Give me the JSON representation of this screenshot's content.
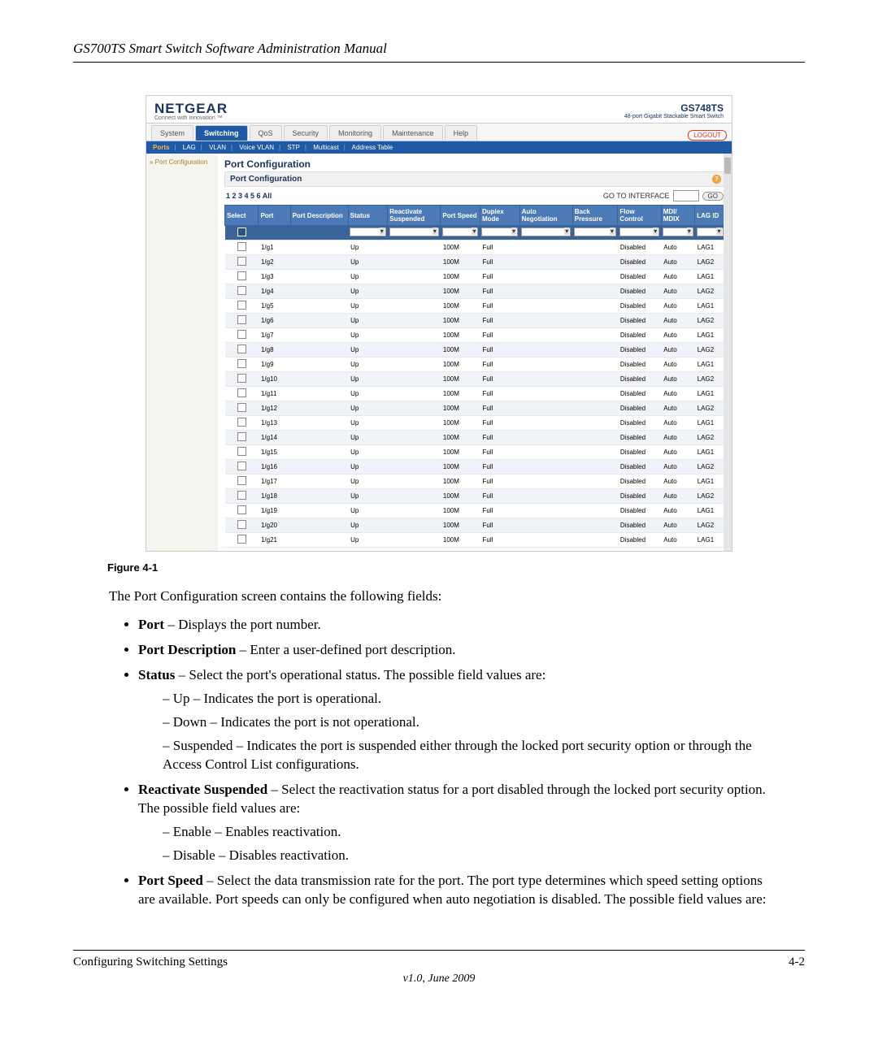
{
  "doc": {
    "header": "GS700TS Smart Switch Software Administration Manual",
    "figure_caption": "Figure 4-1",
    "intro": "The Port Configuration screen contains the following fields:",
    "footer_left": "Configuring Switching Settings",
    "footer_right": "4-2",
    "footer_center": "v1.0, June 2009"
  },
  "fields": {
    "port": {
      "term": "Port",
      "desc": " – Displays the port number."
    },
    "port_desc": {
      "term": "Port Description",
      "desc": " – Enter a user-defined port description."
    },
    "status": {
      "term": "Status",
      "desc": " – Select the port's operational status. The possible field values are:",
      "opts": [
        "Up – Indicates the port is operational.",
        "Down – Indicates the port is not operational.",
        "Suspended – Indicates the port is suspended either through the locked port security option or through the Access Control List configurations."
      ]
    },
    "reactivate": {
      "term": "Reactivate Suspended",
      "desc": " – Select the reactivation status for a port disabled through the locked port security option. The possible field values are:",
      "opts": [
        "Enable – Enables reactivation.",
        "Disable – Disables reactivation."
      ]
    },
    "port_speed": {
      "term": "Port Speed",
      "desc": " – Select the data transmission rate for the port. The port type determines which speed setting options are available. Port speeds can only be configured when auto negotiation is disabled. The possible field values are:"
    }
  },
  "ui": {
    "brand": "NETGEAR",
    "brand_tag": "Connect with Innovation ™",
    "model": "GS748TS",
    "model_tag": "48-port Gigabit Stackable Smart Switch",
    "tabs": [
      "System",
      "Switching",
      "QoS",
      "Security",
      "Monitoring",
      "Maintenance",
      "Help"
    ],
    "active_tab": "Switching",
    "logout": "LOGOUT",
    "subtabs": [
      "Ports",
      "LAG",
      "VLAN",
      "Voice VLAN",
      "STP",
      "Multicast",
      "Address Table"
    ],
    "sidebar_item": "» Port Configuration",
    "section_title": "Port Configuration",
    "section_sub": "Port Configuration",
    "paginator": "1 2 3 4 5 6 All",
    "goto_label": "GO TO INTERFACE",
    "go_btn": "GO",
    "columns": [
      "Select",
      "Port",
      "Port Description",
      "Status",
      "Reactivate Suspended",
      "Port Speed",
      "Duplex Mode",
      "Auto Negotiation",
      "Back Pressure",
      "Flow Control",
      "MDI/ MDIX",
      "LAG ID"
    ],
    "rows": [
      {
        "port": "1/g1",
        "status": "Up",
        "speed": "100M",
        "duplex": "Full",
        "flow": "Disabled",
        "mdi": "Auto",
        "lag": "LAG1"
      },
      {
        "port": "1/g2",
        "status": "Up",
        "speed": "100M",
        "duplex": "Full",
        "flow": "Disabled",
        "mdi": "Auto",
        "lag": "LAG2"
      },
      {
        "port": "1/g3",
        "status": "Up",
        "speed": "100M",
        "duplex": "Full",
        "flow": "Disabled",
        "mdi": "Auto",
        "lag": "LAG1"
      },
      {
        "port": "1/g4",
        "status": "Up",
        "speed": "100M",
        "duplex": "Full",
        "flow": "Disabled",
        "mdi": "Auto",
        "lag": "LAG2"
      },
      {
        "port": "1/g5",
        "status": "Up",
        "speed": "100M",
        "duplex": "Full",
        "flow": "Disabled",
        "mdi": "Auto",
        "lag": "LAG1"
      },
      {
        "port": "1/g6",
        "status": "Up",
        "speed": "100M",
        "duplex": "Full",
        "flow": "Disabled",
        "mdi": "Auto",
        "lag": "LAG2"
      },
      {
        "port": "1/g7",
        "status": "Up",
        "speed": "100M",
        "duplex": "Full",
        "flow": "Disabled",
        "mdi": "Auto",
        "lag": "LAG1"
      },
      {
        "port": "1/g8",
        "status": "Up",
        "speed": "100M",
        "duplex": "Full",
        "flow": "Disabled",
        "mdi": "Auto",
        "lag": "LAG2"
      },
      {
        "port": "1/g9",
        "status": "Up",
        "speed": "100M",
        "duplex": "Full",
        "flow": "Disabled",
        "mdi": "Auto",
        "lag": "LAG1"
      },
      {
        "port": "1/g10",
        "status": "Up",
        "speed": "100M",
        "duplex": "Full",
        "flow": "Disabled",
        "mdi": "Auto",
        "lag": "LAG2"
      },
      {
        "port": "1/g11",
        "status": "Up",
        "speed": "100M",
        "duplex": "Full",
        "flow": "Disabled",
        "mdi": "Auto",
        "lag": "LAG1"
      },
      {
        "port": "1/g12",
        "status": "Up",
        "speed": "100M",
        "duplex": "Full",
        "flow": "Disabled",
        "mdi": "Auto",
        "lag": "LAG2"
      },
      {
        "port": "1/g13",
        "status": "Up",
        "speed": "100M",
        "duplex": "Full",
        "flow": "Disabled",
        "mdi": "Auto",
        "lag": "LAG1"
      },
      {
        "port": "1/g14",
        "status": "Up",
        "speed": "100M",
        "duplex": "Full",
        "flow": "Disabled",
        "mdi": "Auto",
        "lag": "LAG2"
      },
      {
        "port": "1/g15",
        "status": "Up",
        "speed": "100M",
        "duplex": "Full",
        "flow": "Disabled",
        "mdi": "Auto",
        "lag": "LAG1"
      },
      {
        "port": "1/g16",
        "status": "Up",
        "speed": "100M",
        "duplex": "Full",
        "flow": "Disabled",
        "mdi": "Auto",
        "lag": "LAG2"
      },
      {
        "port": "1/g17",
        "status": "Up",
        "speed": "100M",
        "duplex": "Full",
        "flow": "Disabled",
        "mdi": "Auto",
        "lag": "LAG1"
      },
      {
        "port": "1/g18",
        "status": "Up",
        "speed": "100M",
        "duplex": "Full",
        "flow": "Disabled",
        "mdi": "Auto",
        "lag": "LAG2"
      },
      {
        "port": "1/g19",
        "status": "Up",
        "speed": "100M",
        "duplex": "Full",
        "flow": "Disabled",
        "mdi": "Auto",
        "lag": "LAG1"
      },
      {
        "port": "1/g20",
        "status": "Up",
        "speed": "100M",
        "duplex": "Full",
        "flow": "Disabled",
        "mdi": "Auto",
        "lag": "LAG2"
      },
      {
        "port": "1/g21",
        "status": "Up",
        "speed": "100M",
        "duplex": "Full",
        "flow": "Disabled",
        "mdi": "Auto",
        "lag": "LAG1"
      }
    ]
  }
}
